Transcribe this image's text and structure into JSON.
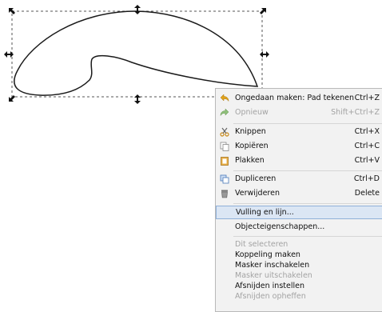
{
  "context_menu": {
    "items": [
      {
        "label": "Ongedaan maken: Pad tekenen",
        "shortcut": "Ctrl+Z",
        "icon": "undo-icon",
        "disabled": false
      },
      {
        "label": "Opnieuw",
        "shortcut": "Shift+Ctrl+Z",
        "icon": "redo-icon",
        "disabled": true
      },
      {
        "label": "Knippen",
        "shortcut": "Ctrl+X",
        "icon": "scissors-icon",
        "disabled": false
      },
      {
        "label": "Kopiëren",
        "shortcut": "Ctrl+C",
        "icon": "copy-icon",
        "disabled": false
      },
      {
        "label": "Plakken",
        "shortcut": "Ctrl+V",
        "icon": "paste-icon",
        "disabled": false
      },
      {
        "label": "Dupliceren",
        "shortcut": "Ctrl+D",
        "icon": "duplicate-icon",
        "disabled": false
      },
      {
        "label": "Verwijderen",
        "shortcut": "Delete",
        "icon": "trash-icon",
        "disabled": false
      },
      {
        "label": "Vulling en lijn...",
        "shortcut": "",
        "icon": "",
        "disabled": false,
        "highlighted": true
      },
      {
        "label": "Objecteigenschappen...",
        "shortcut": "",
        "icon": "",
        "disabled": false
      },
      {
        "label": "Dit selecteren",
        "shortcut": "",
        "icon": "",
        "disabled": true
      },
      {
        "label": "Koppeling maken",
        "shortcut": "",
        "icon": "",
        "disabled": false
      },
      {
        "label": "Masker inschakelen",
        "shortcut": "",
        "icon": "",
        "disabled": false
      },
      {
        "label": "Masker uitschakelen",
        "shortcut": "",
        "icon": "",
        "disabled": true
      },
      {
        "label": "Afsnijden instellen",
        "shortcut": "",
        "icon": "",
        "disabled": false
      },
      {
        "label": "Afsnijden opheffen",
        "shortcut": "",
        "icon": "",
        "disabled": true
      }
    ]
  },
  "colors": {
    "menu_background": "#f2f2f2",
    "highlight_background": "#dbe6f4",
    "highlight_border": "#8fb0d8",
    "disabled_text": "#a3a3a3",
    "path_stroke": "#1a1a1a"
  }
}
